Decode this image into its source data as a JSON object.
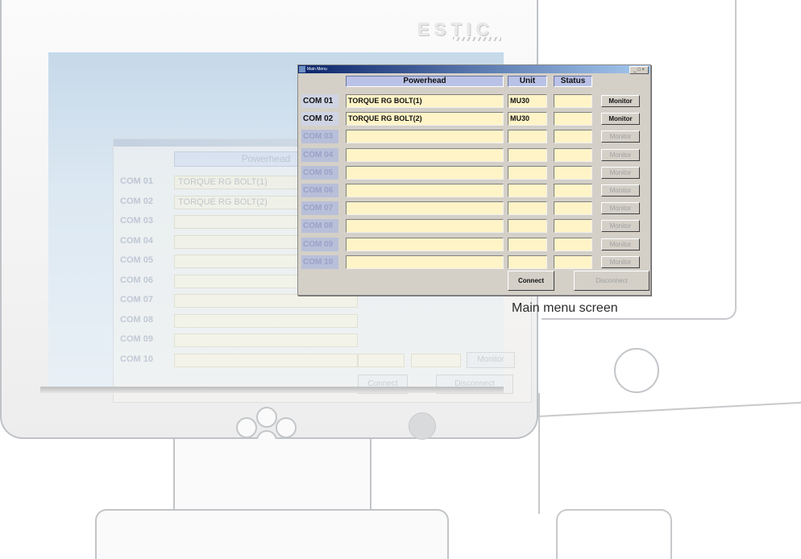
{
  "brand": {
    "logo": "ESTIC"
  },
  "caption": "Main menu screen",
  "main_window": {
    "title": "Main Menu",
    "window_controls": "_ □ ×",
    "headers": {
      "powerhead": "Powerhead",
      "unit": "Unit",
      "status": "Status"
    },
    "rows": [
      {
        "com": "COM 01",
        "powerhead": "TORQUE RG BOLT(1)",
        "unit": "MU30",
        "status": "",
        "button": "Monitor",
        "enabled": true
      },
      {
        "com": "COM 02",
        "powerhead": "TORQUE RG BOLT(2)",
        "unit": "MU30",
        "status": "",
        "button": "Monitor",
        "enabled": true
      },
      {
        "com": "COM 03",
        "powerhead": "",
        "unit": "",
        "status": "",
        "button": "Monitor",
        "enabled": false
      },
      {
        "com": "COM 04",
        "powerhead": "",
        "unit": "",
        "status": "",
        "button": "Monitor",
        "enabled": false
      },
      {
        "com": "COM 05",
        "powerhead": "",
        "unit": "",
        "status": "",
        "button": "Monitor",
        "enabled": false
      },
      {
        "com": "COM 06",
        "powerhead": "",
        "unit": "",
        "status": "",
        "button": "Monitor",
        "enabled": false
      },
      {
        "com": "COM 07",
        "powerhead": "",
        "unit": "",
        "status": "",
        "button": "Monitor",
        "enabled": false
      },
      {
        "com": "COM 08",
        "powerhead": "",
        "unit": "",
        "status": "",
        "button": "Monitor",
        "enabled": false
      },
      {
        "com": "COM 09",
        "powerhead": "",
        "unit": "",
        "status": "",
        "button": "Monitor",
        "enabled": false
      },
      {
        "com": "COM 10",
        "powerhead": "",
        "unit": "",
        "status": "",
        "button": "Monitor",
        "enabled": false
      }
    ],
    "connect_label": "Connect",
    "disconnect_label": "Disconnect"
  },
  "ghost_window": {
    "headers": {
      "powerhead": "Powerhead"
    },
    "rows": [
      {
        "com": "COM 01",
        "powerhead": "TORQUE RG BOLT(1)"
      },
      {
        "com": "COM 02",
        "powerhead": "TORQUE RG BOLT(2)"
      },
      {
        "com": "COM 03",
        "powerhead": ""
      },
      {
        "com": "COM 04",
        "powerhead": ""
      },
      {
        "com": "COM 05",
        "powerhead": ""
      },
      {
        "com": "COM 06",
        "powerhead": ""
      },
      {
        "com": "COM 07",
        "powerhead": ""
      },
      {
        "com": "COM 08",
        "powerhead": ""
      },
      {
        "com": "COM 09",
        "powerhead": ""
      },
      {
        "com": "COM 10",
        "powerhead": ""
      }
    ],
    "monitor_label": "Monitor",
    "connect_label": "Connect",
    "disconnect_label": "Disconnect"
  },
  "colors": {
    "field_fill": "#fff4c7",
    "header_fill": "#b9c2e6",
    "titlebar": "#0a246a",
    "screen_bg": "#dce8f2"
  }
}
